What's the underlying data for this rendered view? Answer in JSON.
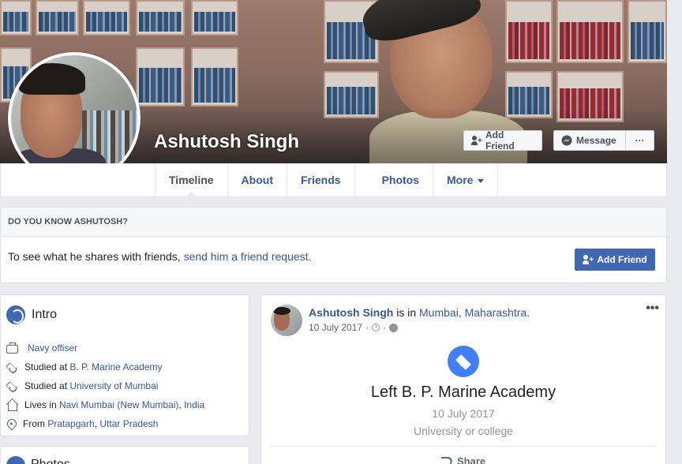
{
  "profile": {
    "name": "Ashutosh Singh"
  },
  "cover_actions": {
    "add_friend_label": "Add Friend",
    "message_label": "Message",
    "more_label": "···"
  },
  "tabs": [
    {
      "label": "Timeline",
      "active": true
    },
    {
      "label": "About"
    },
    {
      "label": "Friends"
    },
    {
      "label": "Photos"
    },
    {
      "label": "More"
    }
  ],
  "know_card": {
    "heading": "DO YOU KNOW ASHUTOSH?",
    "text_prefix": "To see what he shares with friends, ",
    "link_text": "send him a friend request.",
    "button_label": "Add Friend"
  },
  "intro": {
    "title": "Intro",
    "items": [
      {
        "icon": "briefcase-icon",
        "prefix": "",
        "link": "Navy offiser",
        "suffix": "",
        "link2": "",
        "suffix2": ""
      },
      {
        "icon": "graduation-cap-icon",
        "prefix": "Studied at ",
        "link": "B. P. Marine Academy",
        "suffix": "",
        "link2": "",
        "suffix2": ""
      },
      {
        "icon": "graduation-cap-icon",
        "prefix": "Studied at ",
        "link": "University of Mumbai",
        "suffix": "",
        "link2": "",
        "suffix2": ""
      },
      {
        "icon": "home-icon",
        "prefix": "Lives in ",
        "link": "Navi Mumbai (New Mumbai)",
        "suffix": ", ",
        "link2": "India",
        "suffix2": ""
      },
      {
        "icon": "location-pin-icon",
        "prefix": "From ",
        "link": "Pratapgarh",
        "suffix": ", ",
        "link2": "Uttar Pradesh",
        "suffix2": ""
      }
    ]
  },
  "photos_card": {
    "title": "Photos"
  },
  "post": {
    "author": "Ashutosh Singh",
    "action_text": " is in ",
    "place": "Mumbai, Maharashtra.",
    "date": "10 July 2017",
    "meta_separator": "·",
    "more_label": "•••",
    "event": {
      "title": "Left B. P. Marine Academy",
      "date": "10 July 2017",
      "subtitle": "University or college"
    },
    "share_label": "Share"
  },
  "colors": {
    "brand_blue": "#4267b2",
    "link_blue": "#365899",
    "event_icon_blue": "#4080ff",
    "page_bg": "#e9ebee"
  }
}
